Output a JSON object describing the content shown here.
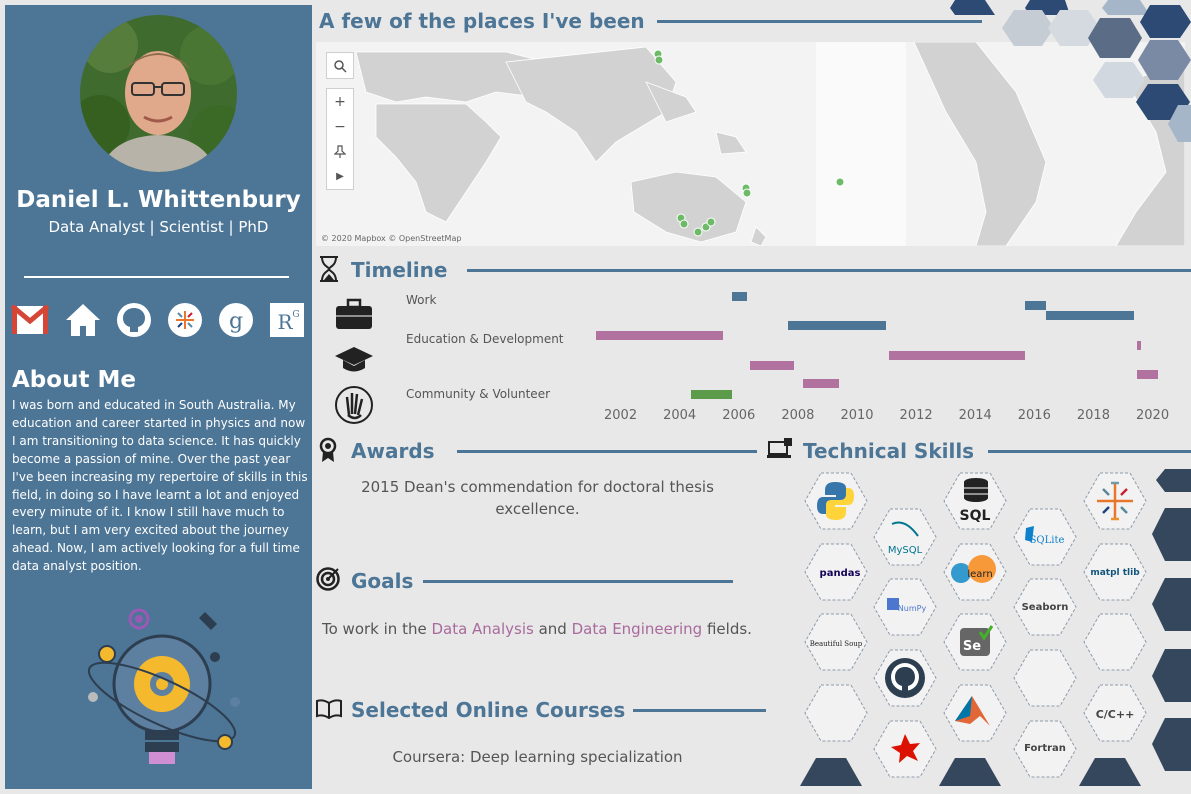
{
  "profile": {
    "name": "Daniel L. Whittenbury",
    "title": "Data Analyst | Scientist | PhD"
  },
  "social_icons": [
    "gmail-icon",
    "home-icon",
    "github-icon",
    "tableau-icon",
    "google-scholar-icon",
    "researchgate-icon"
  ],
  "about": {
    "heading": "About Me",
    "text": "I was born and educated in South Australia. My education and career started in physics and now I am transitioning to data science. It has quickly become a passion of mine. Over the past year I've been increasing my repertoire of skills in this field, in doing so I have learnt a lot and enjoyed every minute of it. I know I still have much to learn, but I am very excited about the journey ahead. Now, I am actively looking for a full time data analyst position."
  },
  "map": {
    "heading": "A few of the places I've been",
    "attribution": "© 2020 Mapbox © OpenStreetMap",
    "marker_color": "#6dbb68"
  },
  "timeline": {
    "heading": "Timeline",
    "categories": [
      "Work",
      "Education & Development",
      "Community & Volunteer"
    ],
    "ticks": [
      "2002",
      "2004",
      "2006",
      "2008",
      "2010",
      "2012",
      "2014",
      "2016",
      "2018",
      "2020"
    ],
    "colors": {
      "work": "#4c7596",
      "education": "#b2729f",
      "community": "#5b9b4a"
    },
    "bars": [
      {
        "cat": "work",
        "start": 2005.8,
        "end": 2006.3,
        "row": 0
      },
      {
        "cat": "work",
        "start": 2007.7,
        "end": 2011.0,
        "row": 1
      },
      {
        "cat": "work",
        "start": 2015.7,
        "end": 2016.4,
        "row": 2
      },
      {
        "cat": "work",
        "start": 2016.4,
        "end": 2019.4,
        "row": 3
      },
      {
        "cat": "education",
        "start": 2001.2,
        "end": 2005.5,
        "row": 4
      },
      {
        "cat": "education",
        "start": 2006.4,
        "end": 2007.9,
        "row": 5
      },
      {
        "cat": "education",
        "start": 2008.2,
        "end": 2009.4,
        "row": 6
      },
      {
        "cat": "education",
        "start": 2011.1,
        "end": 2015.7,
        "row": 7
      },
      {
        "cat": "education",
        "start": 2019.5,
        "end": 2019.6,
        "row": 8
      },
      {
        "cat": "education",
        "start": 2019.5,
        "end": 2020.2,
        "row": 9
      },
      {
        "cat": "community",
        "start": 2004.4,
        "end": 2005.8,
        "row": 10
      }
    ]
  },
  "awards": {
    "heading": "Awards",
    "text": "2015 Dean's commendation for doctoral thesis excellence."
  },
  "goals": {
    "heading": "Goals",
    "prefix": "To work in the ",
    "field1": "Data Analysis",
    "middle": " and ",
    "field2": "Data Engineering",
    "suffix": " fields."
  },
  "courses": {
    "heading": "Selected Online Courses",
    "text": "Coursera: Deep learning specialization"
  },
  "skills": {
    "heading": "Technical Skills",
    "labels": {
      "sql": "SQL",
      "mysql": "MySQL",
      "sqlite": "SQLite",
      "pandas": "pandas",
      "numpy": "NumPy",
      "sklearn": "learn",
      "matplotlib": "matpl  tlib",
      "seaborn": "Seaborn",
      "beautifulsoup": "Beautiful Soup",
      "selenium": "Se",
      "cpp": "C/C++",
      "fortran": "Fortran"
    }
  }
}
